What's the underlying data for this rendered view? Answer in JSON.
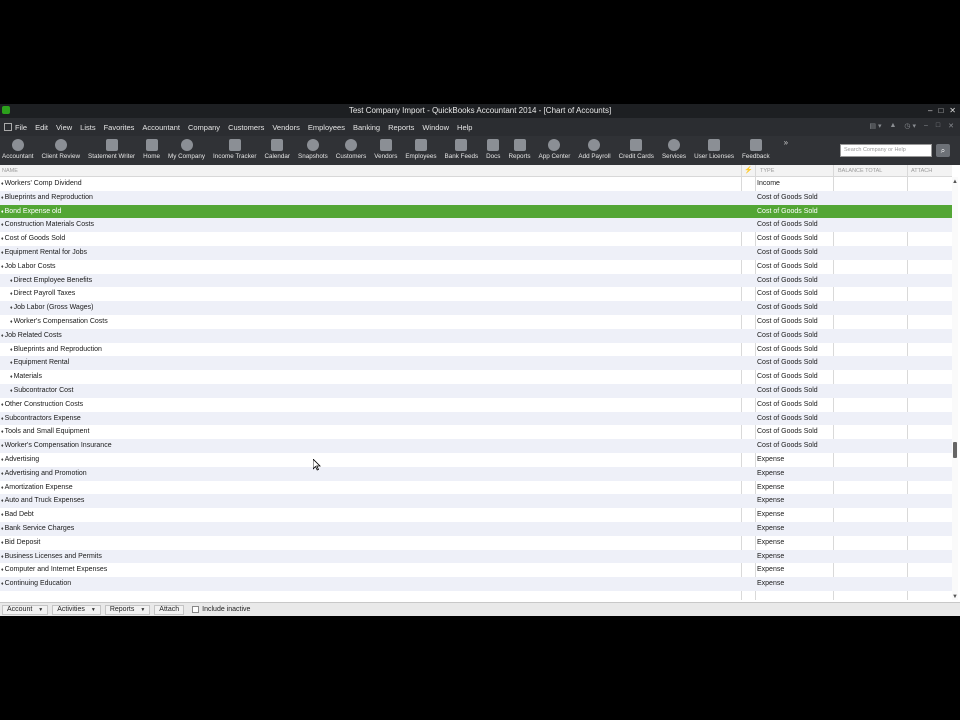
{
  "window": {
    "title": "Test Company Import  - QuickBooks Accountant 2014 - [Chart of Accounts]",
    "buttons": [
      "–",
      "□",
      "✕"
    ]
  },
  "menu": {
    "items": [
      "File",
      "Edit",
      "View",
      "Lists",
      "Favorites",
      "Accountant",
      "Company",
      "Customers",
      "Vendors",
      "Employees",
      "Banking",
      "Reports",
      "Window",
      "Help"
    ],
    "right_controls": [
      "▤ ▾",
      "▲",
      "◷ ▾",
      "–",
      "□",
      "✕"
    ]
  },
  "toolbar": {
    "items": [
      {
        "label": "Accountant",
        "icon": "accountant-icon"
      },
      {
        "label": "Client Review",
        "icon": "client-review-icon"
      },
      {
        "label": "Statement Writer",
        "icon": "statement-writer-icon"
      },
      {
        "label": "Home",
        "icon": "home-icon"
      },
      {
        "label": "My Company",
        "icon": "my-company-icon"
      },
      {
        "label": "Income Tracker",
        "icon": "income-tracker-icon"
      },
      {
        "label": "Calendar",
        "icon": "calendar-icon"
      },
      {
        "label": "Snapshots",
        "icon": "snapshots-icon"
      },
      {
        "label": "Customers",
        "icon": "customers-icon"
      },
      {
        "label": "Vendors",
        "icon": "vendors-icon"
      },
      {
        "label": "Employees",
        "icon": "employees-icon"
      },
      {
        "label": "Bank Feeds",
        "icon": "bank-feeds-icon"
      },
      {
        "label": "Docs",
        "icon": "docs-icon"
      },
      {
        "label": "Reports",
        "icon": "reports-icon"
      },
      {
        "label": "App Center",
        "icon": "app-center-icon"
      },
      {
        "label": "Add Payroll",
        "icon": "add-payroll-icon"
      },
      {
        "label": "Credit Cards",
        "icon": "credit-cards-icon"
      },
      {
        "label": "Services",
        "icon": "services-icon"
      },
      {
        "label": "User Licenses",
        "icon": "user-licenses-icon"
      },
      {
        "label": "Feedback",
        "icon": "feedback-icon"
      }
    ],
    "more": "»",
    "search_placeholder": "Search Company or Help",
    "search_icon": "⌕"
  },
  "table": {
    "columns": {
      "name": "NAME",
      "lightning": "⚡",
      "type": "TYPE",
      "balance": "BALANCE TOTAL",
      "attach": "ATTACH"
    },
    "selected_index": 2,
    "rows": [
      {
        "name": "Workers' Comp Dividend",
        "type": "Income",
        "sub": false
      },
      {
        "name": "Blueprints and Reproduction",
        "type": "Cost of Goods Sold",
        "sub": false
      },
      {
        "name": "Bond Expense old",
        "type": "Cost of Goods Sold",
        "sub": false
      },
      {
        "name": "Construction Materials Costs",
        "type": "Cost of Goods Sold",
        "sub": false
      },
      {
        "name": "Cost of Goods Sold",
        "type": "Cost of Goods Sold",
        "sub": false
      },
      {
        "name": "Equipment Rental for Jobs",
        "type": "Cost of Goods Sold",
        "sub": false
      },
      {
        "name": "Job Labor Costs",
        "type": "Cost of Goods Sold",
        "sub": false
      },
      {
        "name": "Direct Employee Benefits",
        "type": "Cost of Goods Sold",
        "sub": true
      },
      {
        "name": "Direct Payroll Taxes",
        "type": "Cost of Goods Sold",
        "sub": true
      },
      {
        "name": "Job Labor (Gross Wages)",
        "type": "Cost of Goods Sold",
        "sub": true
      },
      {
        "name": "Worker's Compensation Costs",
        "type": "Cost of Goods Sold",
        "sub": true
      },
      {
        "name": "Job Related Costs",
        "type": "Cost of Goods Sold",
        "sub": false
      },
      {
        "name": "Blueprints and Reproduction",
        "type": "Cost of Goods Sold",
        "sub": true
      },
      {
        "name": "Equipment Rental",
        "type": "Cost of Goods Sold",
        "sub": true
      },
      {
        "name": "Materials",
        "type": "Cost of Goods Sold",
        "sub": true
      },
      {
        "name": "Subcontractor Cost",
        "type": "Cost of Goods Sold",
        "sub": true
      },
      {
        "name": "Other Construction Costs",
        "type": "Cost of Goods Sold",
        "sub": false
      },
      {
        "name": "Subcontractors Expense",
        "type": "Cost of Goods Sold",
        "sub": false
      },
      {
        "name": "Tools and Small Equipment",
        "type": "Cost of Goods Sold",
        "sub": false
      },
      {
        "name": "Worker's Compensation Insurance",
        "type": "Cost of Goods Sold",
        "sub": false
      },
      {
        "name": "Advertising",
        "type": "Expense",
        "sub": false
      },
      {
        "name": "Advertising and Promotion",
        "type": "Expense",
        "sub": false
      },
      {
        "name": "Amortization Expense",
        "type": "Expense",
        "sub": false
      },
      {
        "name": "Auto and Truck Expenses",
        "type": "Expense",
        "sub": false
      },
      {
        "name": "Bad Debt",
        "type": "Expense",
        "sub": false
      },
      {
        "name": "Bank Service Charges",
        "type": "Expense",
        "sub": false
      },
      {
        "name": "Bid Deposit",
        "type": "Expense",
        "sub": false
      },
      {
        "name": "Business Licenses and Permits",
        "type": "Expense",
        "sub": false
      },
      {
        "name": "Computer and Internet Expenses",
        "type": "Expense",
        "sub": false
      },
      {
        "name": "Continuing Education",
        "type": "Expense",
        "sub": false
      }
    ]
  },
  "bottom": {
    "account": "Account",
    "activities": "Activities",
    "reports": "Reports",
    "attach": "Attach",
    "include_inactive": "Include inactive"
  },
  "colors": {
    "selected_row": "#53a635",
    "toolbar_bg": "#303236",
    "menubar_bg": "#2b2d31"
  }
}
